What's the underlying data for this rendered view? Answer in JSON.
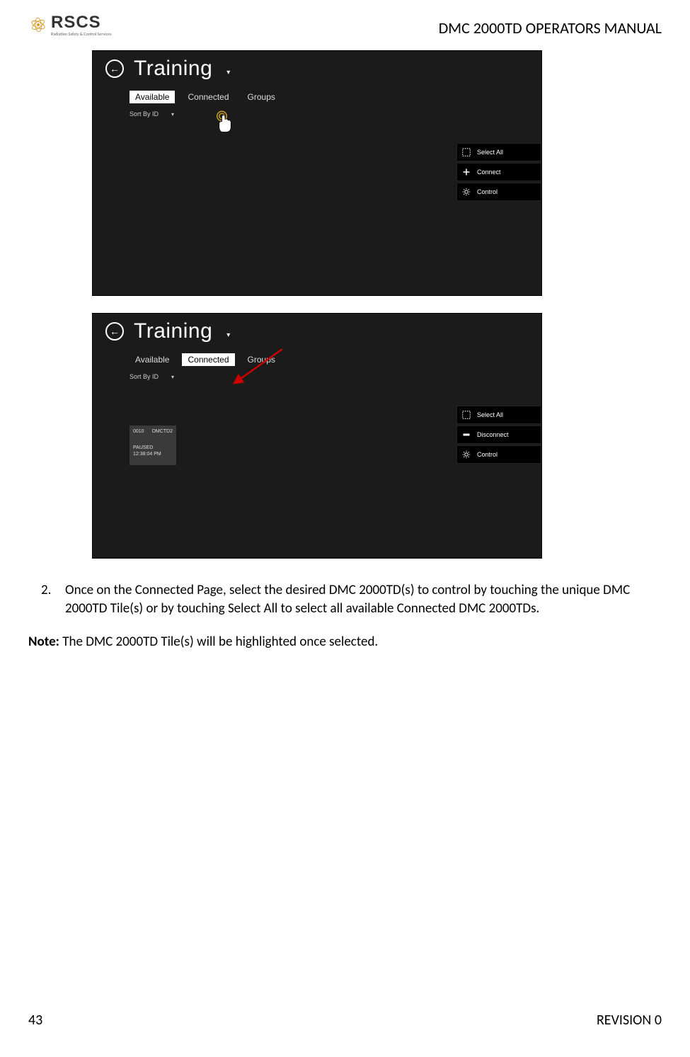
{
  "header": {
    "logo_text": "RSCS",
    "logo_sub": "Radiation Safety & Control Services",
    "doc_title": "DMC 2000TD OPERATORS MANUAL"
  },
  "footer": {
    "page_num": "43",
    "revision": "REVISION 0"
  },
  "shot_common": {
    "back_glyph": "←",
    "title": "Training",
    "chevron": "▾",
    "sort_label": "Sort By ID",
    "sort_chev": "▾"
  },
  "shot1": {
    "tabs": {
      "available": "Available",
      "connected": "Connected",
      "groups": "Groups",
      "selected": "available"
    },
    "panel": {
      "select_all": "Select All",
      "connect": "Connect",
      "control": "Control"
    }
  },
  "shot2": {
    "tabs": {
      "available": "Available",
      "connected": "Connected",
      "groups": "Groups",
      "selected": "connected"
    },
    "panel": {
      "select_all": "Select All",
      "disconnect": "Disconnect",
      "control": "Control"
    },
    "tile": {
      "id": "0010",
      "model": "DMCTD2",
      "status": "PAUSED",
      "time": "12:38:04 PM"
    }
  },
  "body": {
    "step_num": "2.",
    "step_text": "Once on the Connected Page, select the desired DMC 2000TD(s) to control by touching the unique DMC 2000TD Tile(s) or by touching Select All to select all available Connected DMC 2000TDs.",
    "note_label": "Note:",
    "note_text": " The DMC 2000TD Tile(s) will be highlighted once selected."
  }
}
